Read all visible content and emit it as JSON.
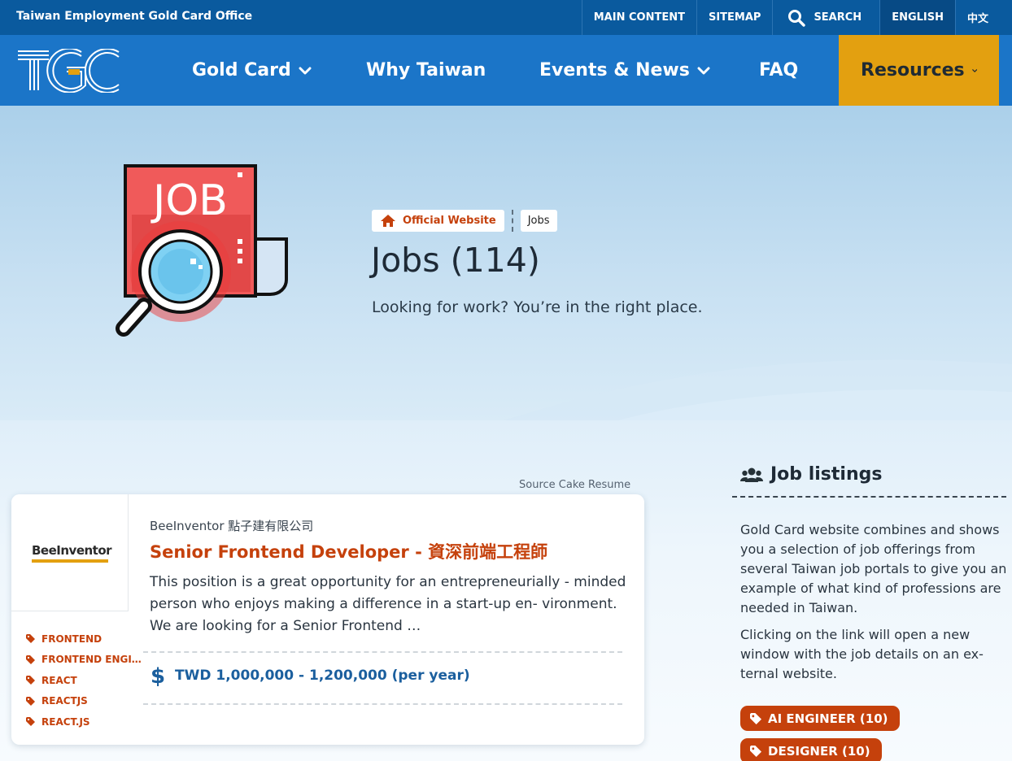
{
  "topbar": {
    "office_name": "Taiwan Employment Gold Card Office",
    "links": {
      "main_content": "MAIN CONTENT",
      "sitemap": "SITEMAP",
      "search": "SEARCH",
      "english": "ENGLISH",
      "chinese": "中文"
    }
  },
  "nav": {
    "logo_text": "TGC",
    "items": {
      "gold_card": "Gold Card",
      "why_taiwan": "Why Taiwan",
      "events_news": "Events & News",
      "faq": "FAQ",
      "resources": "Resources"
    }
  },
  "hero": {
    "icon_text": "JOB",
    "breadcrumb": {
      "home": "Official Website",
      "current": "Jobs"
    },
    "title": "Jobs (114)",
    "subtitle": "Looking for work? You’re in the right place."
  },
  "listing": {
    "source": "Source Cake Resume",
    "company_logo_text": "BeeInventor",
    "company": "BeeInventor 點子建有限公司",
    "title": "Senior Frontend Developer - 資深前端工程師",
    "description": "This position is a great opportunity for an entrepreneurially - minded person who enjoys making a difference in a start-up en- vironment. We are looking for a Senior Frontend …",
    "salary": "TWD 1,000,000 - 1,200,000 (per year)",
    "tags": [
      "FRONTEND",
      "FRONTEND ENGI…",
      "REACT",
      "REACTJS",
      "REACT.JS"
    ]
  },
  "sidebar": {
    "title": "Job listings",
    "p1": "Gold Card website combines and shows you a selection of job offerings from several Taiwan job portals to give you an example of what kind of professions are needed in Taiwan.",
    "p2": "Clicking on the link will open a new window with the job details on an ex- ternal website.",
    "categories": [
      "AI ENGINEER (10)",
      "DESIGNER (10)"
    ]
  },
  "colors": {
    "topbar": "#0a5a9e",
    "nav": "#1b75c8",
    "resources_accent": "#e3a010",
    "link_orange": "#c5410c",
    "salary_blue": "#1b5f9e"
  },
  "icons": {
    "search": "search-icon",
    "chevron": "chevron-down-icon",
    "home": "home-icon",
    "tag": "tag-icon",
    "dollar": "dollar-icon",
    "users": "users-icon"
  }
}
